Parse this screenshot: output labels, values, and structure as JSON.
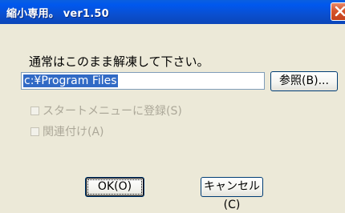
{
  "window": {
    "title": "縮小専用。 ver1.50",
    "close_icon": "close-icon"
  },
  "dialog": {
    "message": "通常はこのまま解凍して下さい。",
    "path_value": "c:¥Program Files",
    "browse_label": "参照(B)...",
    "checkboxes": [
      {
        "label": "スタートメニューに登録(S)",
        "checked": false,
        "enabled": false
      },
      {
        "label": "関連付け(A)",
        "checked": false,
        "enabled": false
      }
    ],
    "ok_label": "OK(O)",
    "cancel_label": "キャンセル(C)"
  },
  "colors": {
    "titlebar": "#0a4fd0",
    "dialog_background": "#ece9d8",
    "selection": "#316ac5",
    "disabled_text": "#aca899",
    "close_button": "#d6542c"
  }
}
